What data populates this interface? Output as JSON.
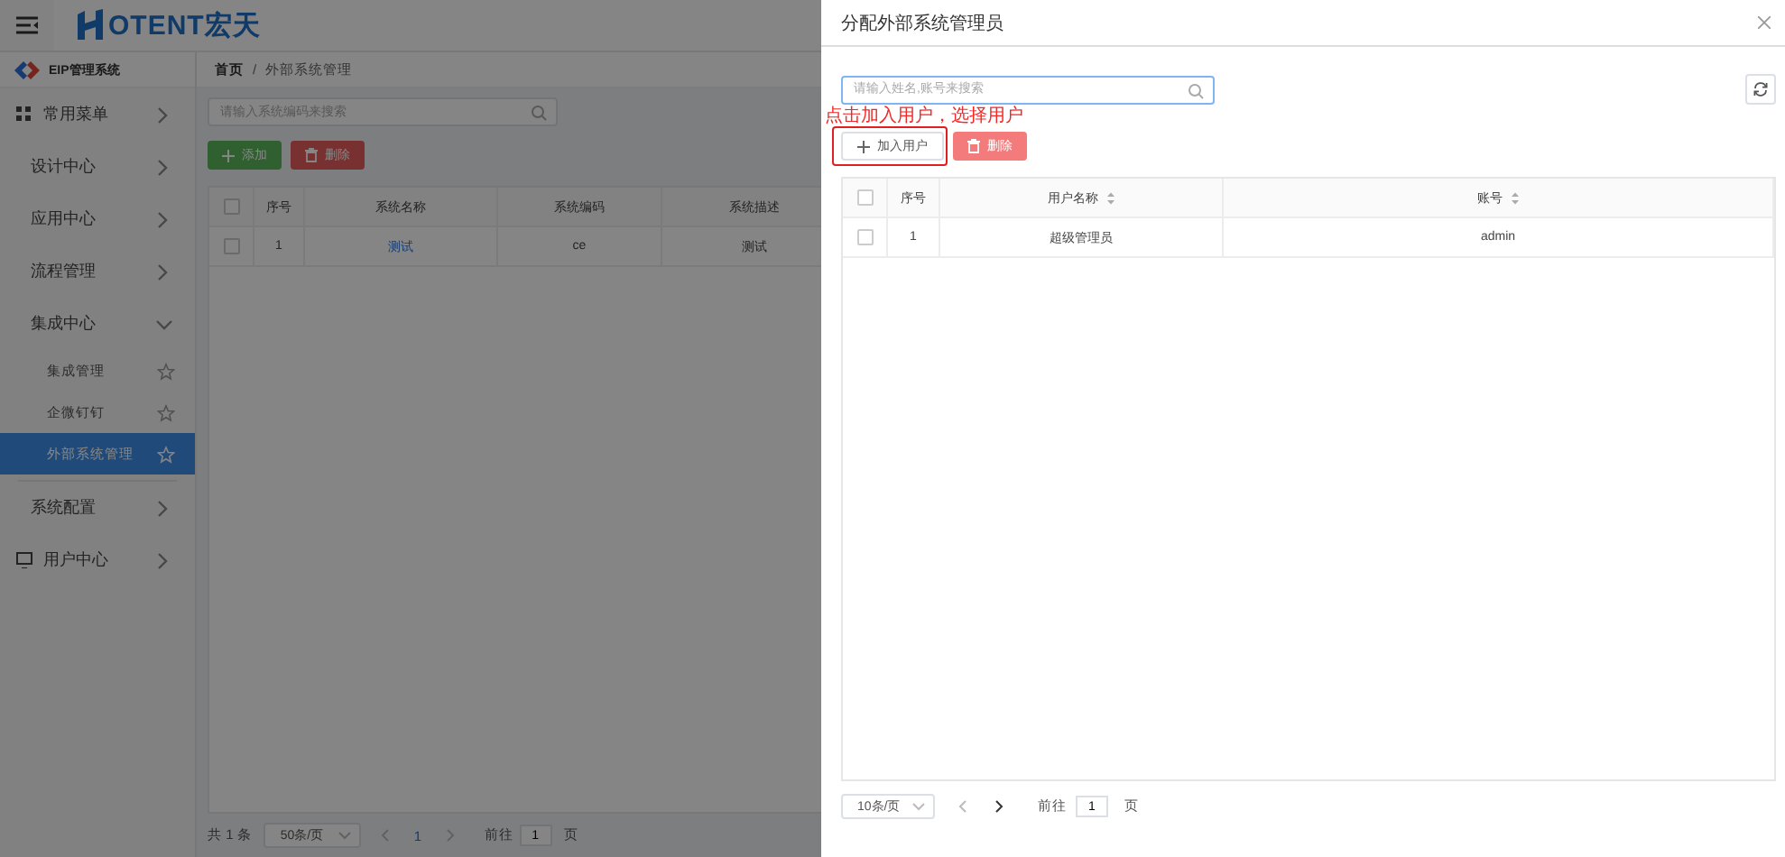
{
  "header": {
    "logo_text": "OTENT宏天"
  },
  "sidebar": {
    "brand": "EIP管理系统",
    "items": [
      {
        "label": "常用菜单",
        "kind": "favorites",
        "expanded": false
      },
      {
        "label": "设计中心",
        "kind": "module",
        "expanded": false
      },
      {
        "label": "应用中心",
        "kind": "module",
        "expanded": false
      },
      {
        "label": "流程管理",
        "kind": "module",
        "expanded": false
      },
      {
        "label": "集成中心",
        "kind": "module",
        "expanded": true,
        "children": [
          {
            "label": "集成管理",
            "selected": false
          },
          {
            "label": "企微钉钉",
            "selected": false
          },
          {
            "label": "外部系统管理",
            "selected": true
          }
        ]
      },
      {
        "label": "系统配置",
        "kind": "module",
        "expanded": false
      },
      {
        "label": "用户中心",
        "kind": "user",
        "expanded": false
      }
    ]
  },
  "main": {
    "breadcrumb": [
      "首页",
      "外部系统管理"
    ],
    "breadcrumb_separator": "/",
    "search": {
      "placeholder": "请输入系统编码来搜索"
    },
    "buttons": [
      {
        "label": "添加",
        "kind": "add"
      },
      {
        "label": "删除",
        "kind": "delete"
      }
    ],
    "table": {
      "all_checked": false,
      "columns": [
        "序号",
        "系统名称",
        "系统编码",
        "系统描述"
      ],
      "rows": [
        {
          "checked": false,
          "cells": [
            "1",
            "测试",
            "ce",
            "测试"
          ]
        }
      ]
    },
    "pagination": {
      "total": "共 1 条",
      "page_size": "50条/页",
      "pages": [
        "1"
      ],
      "goto_label": "前往",
      "goto_value": "1",
      "page_unit": "页"
    }
  },
  "drawer": {
    "title": "分配外部系统管理员",
    "search": {
      "placeholder": "请输入姓名,账号来搜索"
    },
    "buttons": [
      {
        "label": "加入用户",
        "kind": "add"
      },
      {
        "label": "删除",
        "kind": "delete"
      }
    ],
    "table": {
      "all_checked": false,
      "columns": [
        {
          "label": "序号",
          "sortable": false
        },
        {
          "label": "用户名称",
          "sortable": true
        },
        {
          "label": "账号",
          "sortable": true
        }
      ],
      "rows": [
        {
          "checked": false,
          "cells": [
            "1",
            "超级管理员",
            "admin"
          ]
        }
      ]
    },
    "pagination": {
      "page_size": "10条/页",
      "goto_label": "前往",
      "goto_value": "1",
      "page_unit": "页"
    }
  },
  "annotation": {
    "text": "点击加入用户，选择用户"
  }
}
